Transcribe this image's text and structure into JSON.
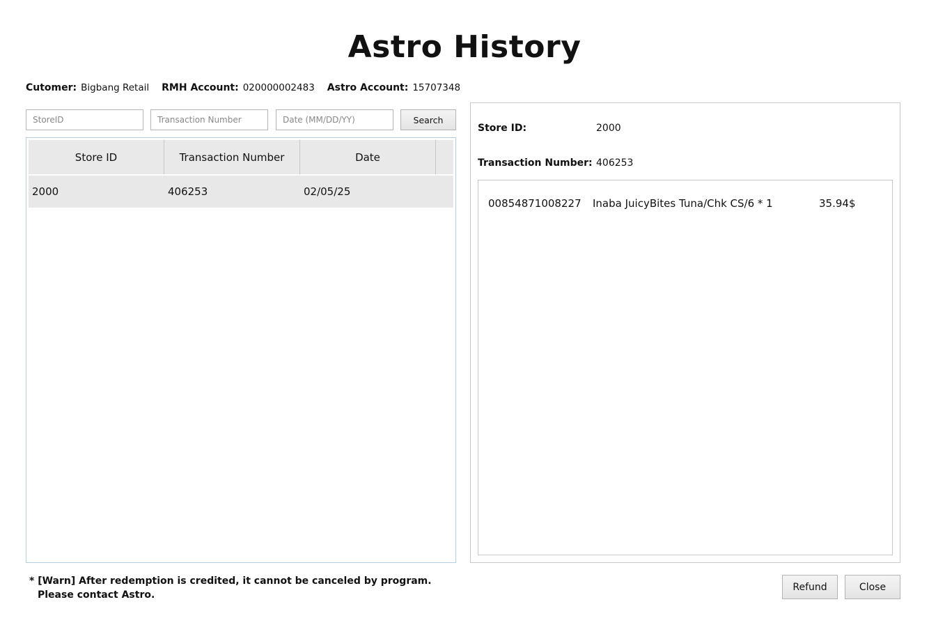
{
  "window": {
    "title": "Astro History"
  },
  "info": {
    "customer_label": "Cutomer:",
    "customer_value": "Bigbang Retail",
    "rmh_label": "RMH Account:",
    "rmh_value": "020000002483",
    "astro_label": "Astro Account:",
    "astro_value": "15707348"
  },
  "search": {
    "store_placeholder": "StoreID",
    "store_value": "",
    "txn_placeholder": "Transaction Number",
    "txn_value": "",
    "date_placeholder": "Date (MM/DD/YY)",
    "date_value": "",
    "button_label": "Search"
  },
  "list": {
    "columns": [
      "Store ID",
      "Transaction Number",
      "Date",
      ""
    ],
    "rows": [
      {
        "store_id": "2000",
        "transaction_number": "406253",
        "date": "02/05/25"
      }
    ]
  },
  "detail": {
    "store_id_label": "Store ID:",
    "store_id_value": "2000",
    "txn_label": "Transaction Number:",
    "txn_value": "406253",
    "items": [
      {
        "code": "00854871008227",
        "description": "Inaba JuicyBites Tuna/Chk CS/6 * 1",
        "price": "35.94$"
      }
    ]
  },
  "warning": {
    "line1": "* [Warn] After redemption is credited, it cannot be canceled by program.",
    "line2": "Please contact Astro."
  },
  "buttons": {
    "refund_label": "Refund",
    "close_label": "Close"
  }
}
